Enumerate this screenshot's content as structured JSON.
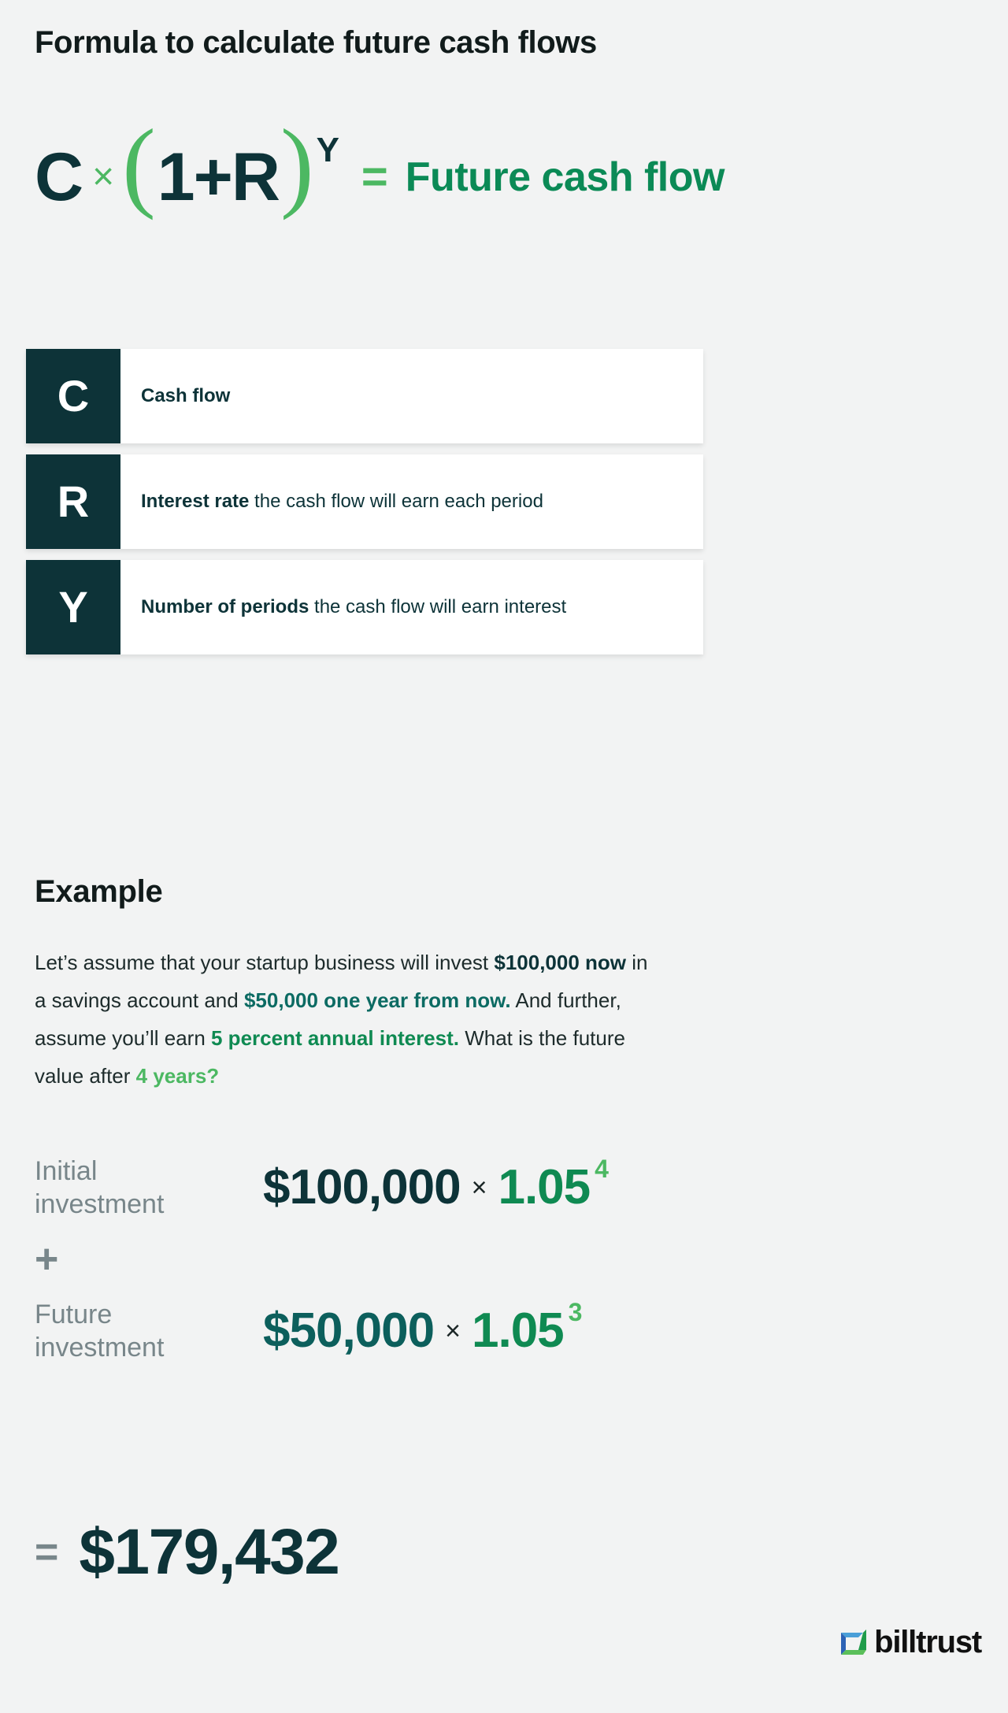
{
  "title": "Formula to calculate future cash flows",
  "formula": {
    "c": "C",
    "times": "×",
    "left_paren": "(",
    "inner": "1+R",
    "right_paren": ")",
    "exponent": "Y",
    "equals": "=",
    "result": "Future cash flow"
  },
  "legend": [
    {
      "symbol": "C",
      "term": "Cash flow",
      "rest": ""
    },
    {
      "symbol": "R",
      "term": "Interest rate",
      "rest": " the cash flow will earn each period"
    },
    {
      "symbol": "Y",
      "term": "Number of periods",
      "rest": " the cash flow will earn interest"
    }
  ],
  "example": {
    "heading": "Example",
    "paragraph": {
      "seg1": "Let’s assume that your startup business will invest ",
      "hl1": "$100,000 now",
      "seg2": " in a savings account and ",
      "hl2": "$50,000 one year from now.",
      "seg3": " And further, assume you’ll earn ",
      "hl3": "5 percent annual interest.",
      "seg4": " What is the future value after ",
      "hl4": "4 years?"
    }
  },
  "calculation": {
    "rows": [
      {
        "label_line1": "Initial",
        "label_line2": "investment",
        "amount": "$100,000",
        "operator": "×",
        "base": "1.05",
        "power": "4"
      },
      {
        "label_line1": "Future",
        "label_line2": "investment",
        "amount": "$50,000",
        "operator": "×",
        "base": "1.05",
        "power": "3"
      }
    ],
    "plus": "+",
    "equals": "=",
    "total": "$179,432"
  },
  "logo": {
    "wordmark": "billtrust",
    "mark_colors": {
      "top": "#4a9fd8",
      "left": "#2c62b5",
      "right": "#1f9c4a",
      "bottom": "#5bbf5a"
    }
  },
  "colors": {
    "background": "#f2f3f3",
    "navy": "#0d3338",
    "green_light": "#4cb862",
    "green_mid": "#0f8a52",
    "green_emerald": "#0b8a56",
    "grey": "#78868a",
    "card": "#ffffff"
  }
}
